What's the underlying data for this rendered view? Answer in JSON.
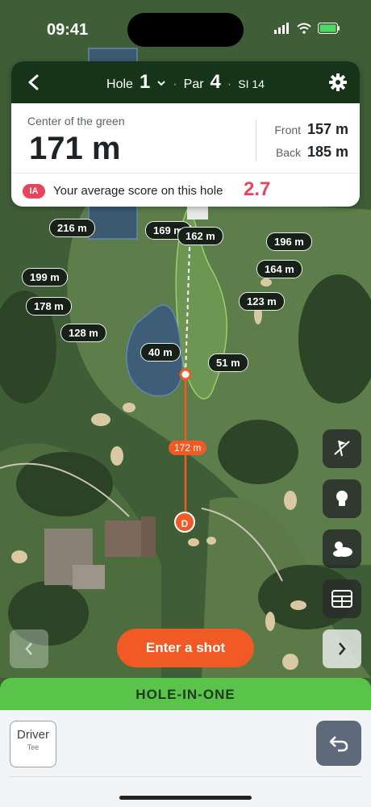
{
  "status_bar": {
    "time": "09:41"
  },
  "header": {
    "hole_label": "Hole",
    "hole_number": "1",
    "par_label": "Par",
    "par_number": "4",
    "si_label": "SI 14"
  },
  "distance": {
    "center_label": "Center of the green",
    "center_value": "171 m",
    "front_label": "Front",
    "front_value": "157 m",
    "back_label": "Back",
    "back_value": "185 m"
  },
  "average": {
    "badge": "IA",
    "text": "Your average score on this hole",
    "value": "2.7"
  },
  "map_tags": [
    "216 m",
    "169 m",
    "162 m",
    "196 m",
    "199 m",
    "164 m",
    "178 m",
    "123 m",
    "128 m",
    "40 m",
    "51 m"
  ],
  "shot": {
    "distance": "172 m",
    "marker": "D"
  },
  "actions": {
    "enter_shot": "Enter a shot",
    "hole_in_one": "HOLE-IN-ONE"
  },
  "club": {
    "name": "Driver",
    "sub": "Tee"
  },
  "colors": {
    "accent": "#f15a24",
    "header_bg": "#163419",
    "hio_green": "#5ac34a",
    "avg_red": "#e8455d"
  },
  "icons": [
    "back-icon",
    "chevron-down-icon",
    "gear-icon",
    "pin-icon",
    "lightbulb-icon",
    "weather-icon",
    "scorecard-icon",
    "chevron-left-icon",
    "chevron-right-icon",
    "undo-icon"
  ]
}
